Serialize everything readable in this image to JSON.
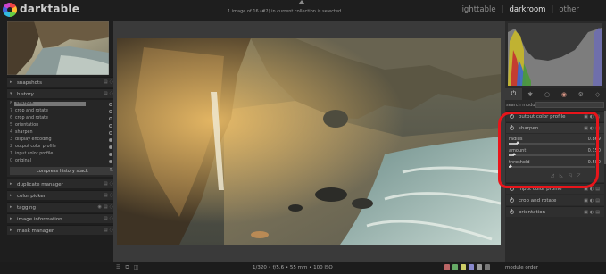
{
  "app": {
    "title": "darktable"
  },
  "header": {
    "collection_info": "1 image of 16 (#2) in current collection is selected",
    "views": [
      {
        "label": "lighttable",
        "active": false
      },
      {
        "label": "darkroom",
        "active": true
      },
      {
        "label": "other",
        "active": false
      }
    ],
    "separator": "|"
  },
  "left_panel": {
    "snapshots_label": "snapshots",
    "history_label": "history",
    "history_items": [
      {
        "num": "8",
        "name": "sharpen",
        "selected": true,
        "enabled": false
      },
      {
        "num": "7",
        "name": "crop and rotate",
        "selected": false,
        "enabled": false
      },
      {
        "num": "6",
        "name": "crop and rotate",
        "selected": false,
        "enabled": false
      },
      {
        "num": "5",
        "name": "orientation",
        "selected": false,
        "enabled": false
      },
      {
        "num": "4",
        "name": "sharpen",
        "selected": false,
        "enabled": false
      },
      {
        "num": "3",
        "name": "display encoding",
        "selected": false,
        "enabled": true
      },
      {
        "num": "2",
        "name": "output color profile",
        "selected": false,
        "enabled": true
      },
      {
        "num": "1",
        "name": "input color profile",
        "selected": false,
        "enabled": true
      },
      {
        "num": "0",
        "name": "original",
        "selected": false,
        "enabled": true
      }
    ],
    "compress_label": "compress history stack",
    "sections_below": [
      {
        "label": "duplicate manager"
      },
      {
        "label": "color picker"
      },
      {
        "label": "tagging"
      },
      {
        "label": "image information"
      },
      {
        "label": "mask manager"
      }
    ]
  },
  "bottom_bar": {
    "exif": "1/320 • f/5.6 • 55 mm • 100 ISO",
    "module_order_label": "module order"
  },
  "right_panel": {
    "group_tabs": [
      {
        "icon": "power-icon",
        "glyph": "⏻",
        "active": true
      },
      {
        "icon": "star-icon",
        "glyph": "✱",
        "active": false
      },
      {
        "icon": "circle-icon",
        "glyph": "○",
        "active": false
      },
      {
        "icon": "color-wheel-icon",
        "glyph": "◉",
        "active": false
      },
      {
        "icon": "gear-icon",
        "glyph": "⚙",
        "active": false
      },
      {
        "icon": "diamond-icon",
        "glyph": "◇",
        "active": false
      }
    ],
    "search_label": "search module",
    "search_value": "",
    "modules_top": [
      {
        "name": "output color profile"
      }
    ],
    "sharpen": {
      "name": "sharpen",
      "sliders": [
        {
          "label": "radius",
          "value": "0.869",
          "fraction": 0.1
        },
        {
          "label": "amount",
          "value": "0.150",
          "fraction": 0.06
        },
        {
          "label": "threshold",
          "value": "0.500",
          "fraction": 0.02
        }
      ]
    },
    "modules_bottom": [
      {
        "name": "input color profile"
      },
      {
        "name": "crop and rotate"
      },
      {
        "name": "orientation"
      }
    ]
  },
  "colors": {
    "highlight": "#e8151b",
    "selected_history": "#777777",
    "accent": "#e6e6e6"
  }
}
